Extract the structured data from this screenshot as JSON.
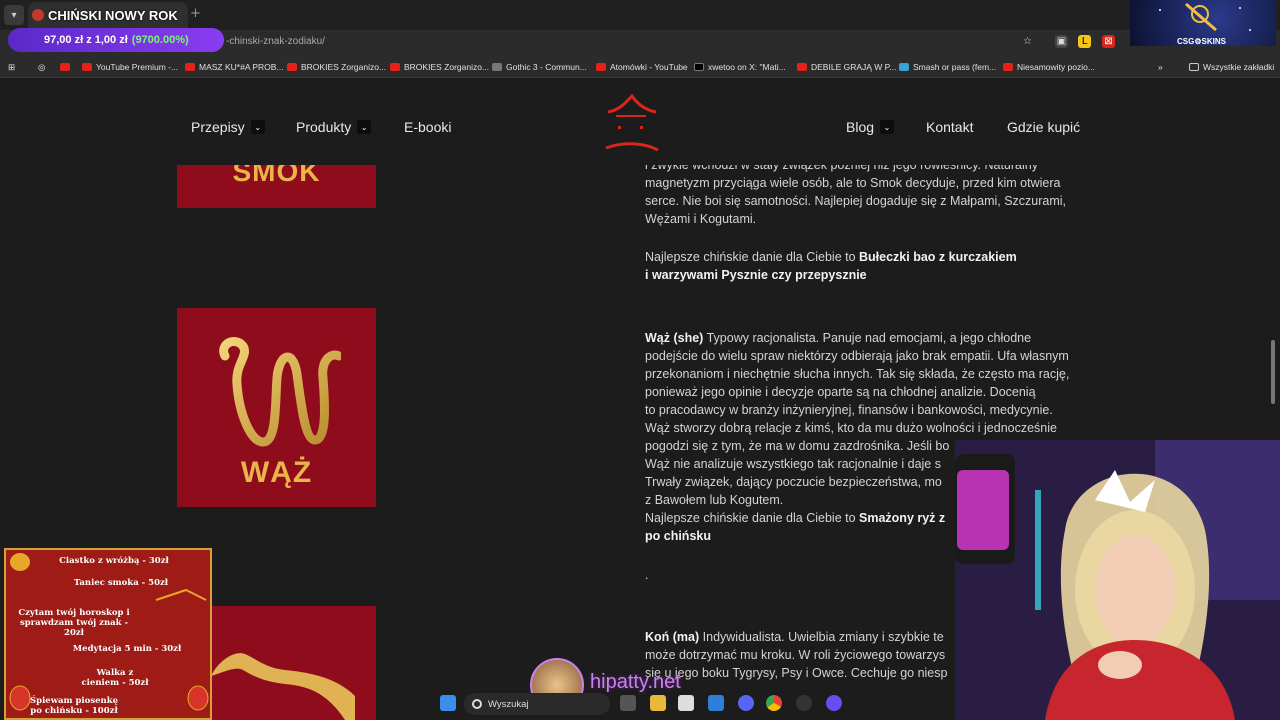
{
  "browser": {
    "tab_title": "CHIŃSKI NOWY ROK",
    "new_tab": "+",
    "promo_price": "97,00 zł z 1,00 zł",
    "promo_percent": "(9700.00%)",
    "url": "-chinski-znak-zodiaku/",
    "bookmarks": [
      "YouTube Premium -...",
      "MASZ KU*#A PROB...",
      "BROKIES Zorganizo...",
      "BROKIES Zorganizo...",
      "Gothic 3 - Commun...",
      "Atomówki - YouTube",
      "xwetoo on X: \"Mati...",
      "DEBILE GRAJĄ W P...",
      "Smash or pass (fem...",
      "Niesamowity pozio..."
    ],
    "all_bookmarks": "Wszystkie zakładki"
  },
  "site": {
    "nav_left": [
      "Przepisy",
      "Produkty",
      "E-booki"
    ],
    "nav_right": [
      "Blog",
      "Kontakt",
      "Gdzie kupić"
    ]
  },
  "cards": {
    "smok": "SMOK",
    "waz": "WĄŻ"
  },
  "content": {
    "smok_lines": [
      "i zwykle wchodzi w stały związek później niż jego rówieśnicy. Naturalny",
      "magnetyzm przyciąga wiele osób, ale to Smok decyduje, przed kim otwiera",
      "serce. Nie boi się samotności. Najlepiej dogaduje się z Małpami, Szczurami,",
      "Wężami i Kogutami."
    ],
    "smok_dish_prefix": "Najlepsze chińskie danie dla Ciebie to ",
    "smok_dish_bold1": "Bułeczki bao z kurczakiem",
    "smok_dish_bold2": "i warzywami Pysznie czy przepysznie",
    "waz_head": "Wąż (she)",
    "waz_line1_rest": " Typowy racjonalista. Panuje nad emocjami, a jego chłodne",
    "waz_lines": [
      "podejście do wielu spraw niektórzy odbierają jako brak empatii. Ufa własnym",
      "przekonaniom i niechętnie słucha innych. Tak się składa, że często ma rację,",
      "ponieważ jego opinie i decyzje oparte są na chłodnej analizie. Docenią",
      "to pracodawcy w branży inżynieryjnej, finansów i bankowości, medycynie.",
      "Wąż stworzy dobrą relacje z kimś, kto da mu dużo wolności i jednocześnie",
      "pogodzi się z tym, że ma w domu zazdrośnika. Jeśli bo",
      "Wąż nie analizuje wszystkiego tak racjonalnie i daje s",
      "Trwały związek, dający poczucie bezpieczeństwa, mo",
      "z Bawołem lub Kogutem."
    ],
    "waz_dish_prefix": "Najlepsze chińskie danie dla Ciebie to ",
    "waz_dish_bold": "Smażony ryż z",
    "waz_dish_bold2": "po chińsku",
    "dot": ".",
    "kon_head": "Koń (ma)",
    "kon_line1_rest": " Indywidualista. Uwielbia zmiany i szybkie te",
    "kon_lines": [
      "może dotrzymać mu kroku. W roli życiowego towarzys",
      "się u jego boku Tygrysy, Psy i Owce. Cechuje go niesp"
    ]
  },
  "overlays": {
    "csg": "CSG⚙SKINS",
    "menu_items": [
      "Ciastko z wróżbą - 30zł",
      "Taniec smoka - 50zł",
      "Czytam twój horoskop i sprawdzam twój znak - 20zł",
      "Medytacja 5 min - 30zł",
      "Walka z cieniem - 50zł",
      "Śpiewam piosenkę po chińsku - 100zł"
    ],
    "brand": "hipatty.net",
    "search_placeholder": "Wyszukaj"
  },
  "colors": {
    "card_red": "#8f0c1d",
    "gold": "#e9b54a",
    "site_bg": "#1c1c1c",
    "logo_red": "#d9251c"
  }
}
